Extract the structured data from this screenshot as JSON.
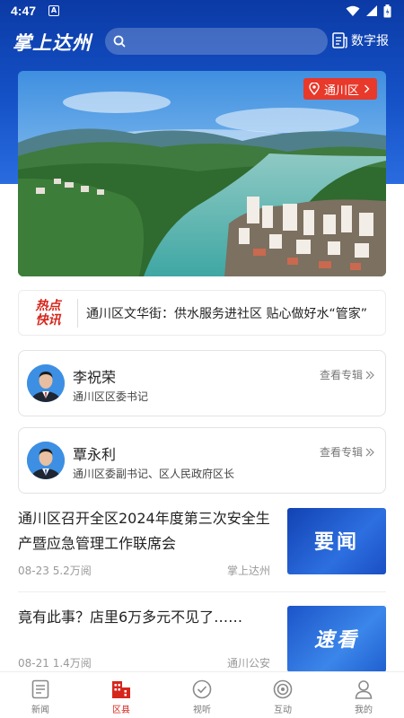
{
  "status_bar": {
    "time": "4:47",
    "notif": "A"
  },
  "header": {
    "logo": "掌上达州",
    "search_placeholder": "",
    "digital_label": "数字报"
  },
  "hero": {
    "location_tag": "通川区"
  },
  "flash": {
    "badge_line1": "热点",
    "badge_line2": "快讯",
    "text": "通川区文华街：供水服务进社区 贴心做好水“管家”"
  },
  "leaders": [
    {
      "name": "李祝荣",
      "title": "通川区区委书记",
      "link": "查看专辑"
    },
    {
      "name": "覃永利",
      "title": "通川区委副书记、区人民政府区长",
      "link": "查看专辑"
    }
  ],
  "articles": [
    {
      "title": "通川区召开全区2024年度第三次安全生产暨应急管理工作联席会",
      "date": "08-23",
      "views": "5.2万阅",
      "source": "掌上达州",
      "thumb_text": "要闻"
    },
    {
      "title": "竟有此事？店里6万多元不见了……",
      "date": "08-21",
      "views": "1.4万阅",
      "source": "通川公安",
      "thumb_text": "速看"
    }
  ],
  "bottom_nav": [
    {
      "label": "新闻",
      "icon": "news-icon"
    },
    {
      "label": "区县",
      "icon": "district-icon",
      "active": true
    },
    {
      "label": "视听",
      "icon": "media-icon"
    },
    {
      "label": "互动",
      "icon": "interact-icon"
    },
    {
      "label": "我的",
      "icon": "profile-icon"
    }
  ],
  "colors": {
    "header_blue": "#1552c8",
    "accent_red": "#d6261c",
    "tag_red": "#e8392b"
  }
}
